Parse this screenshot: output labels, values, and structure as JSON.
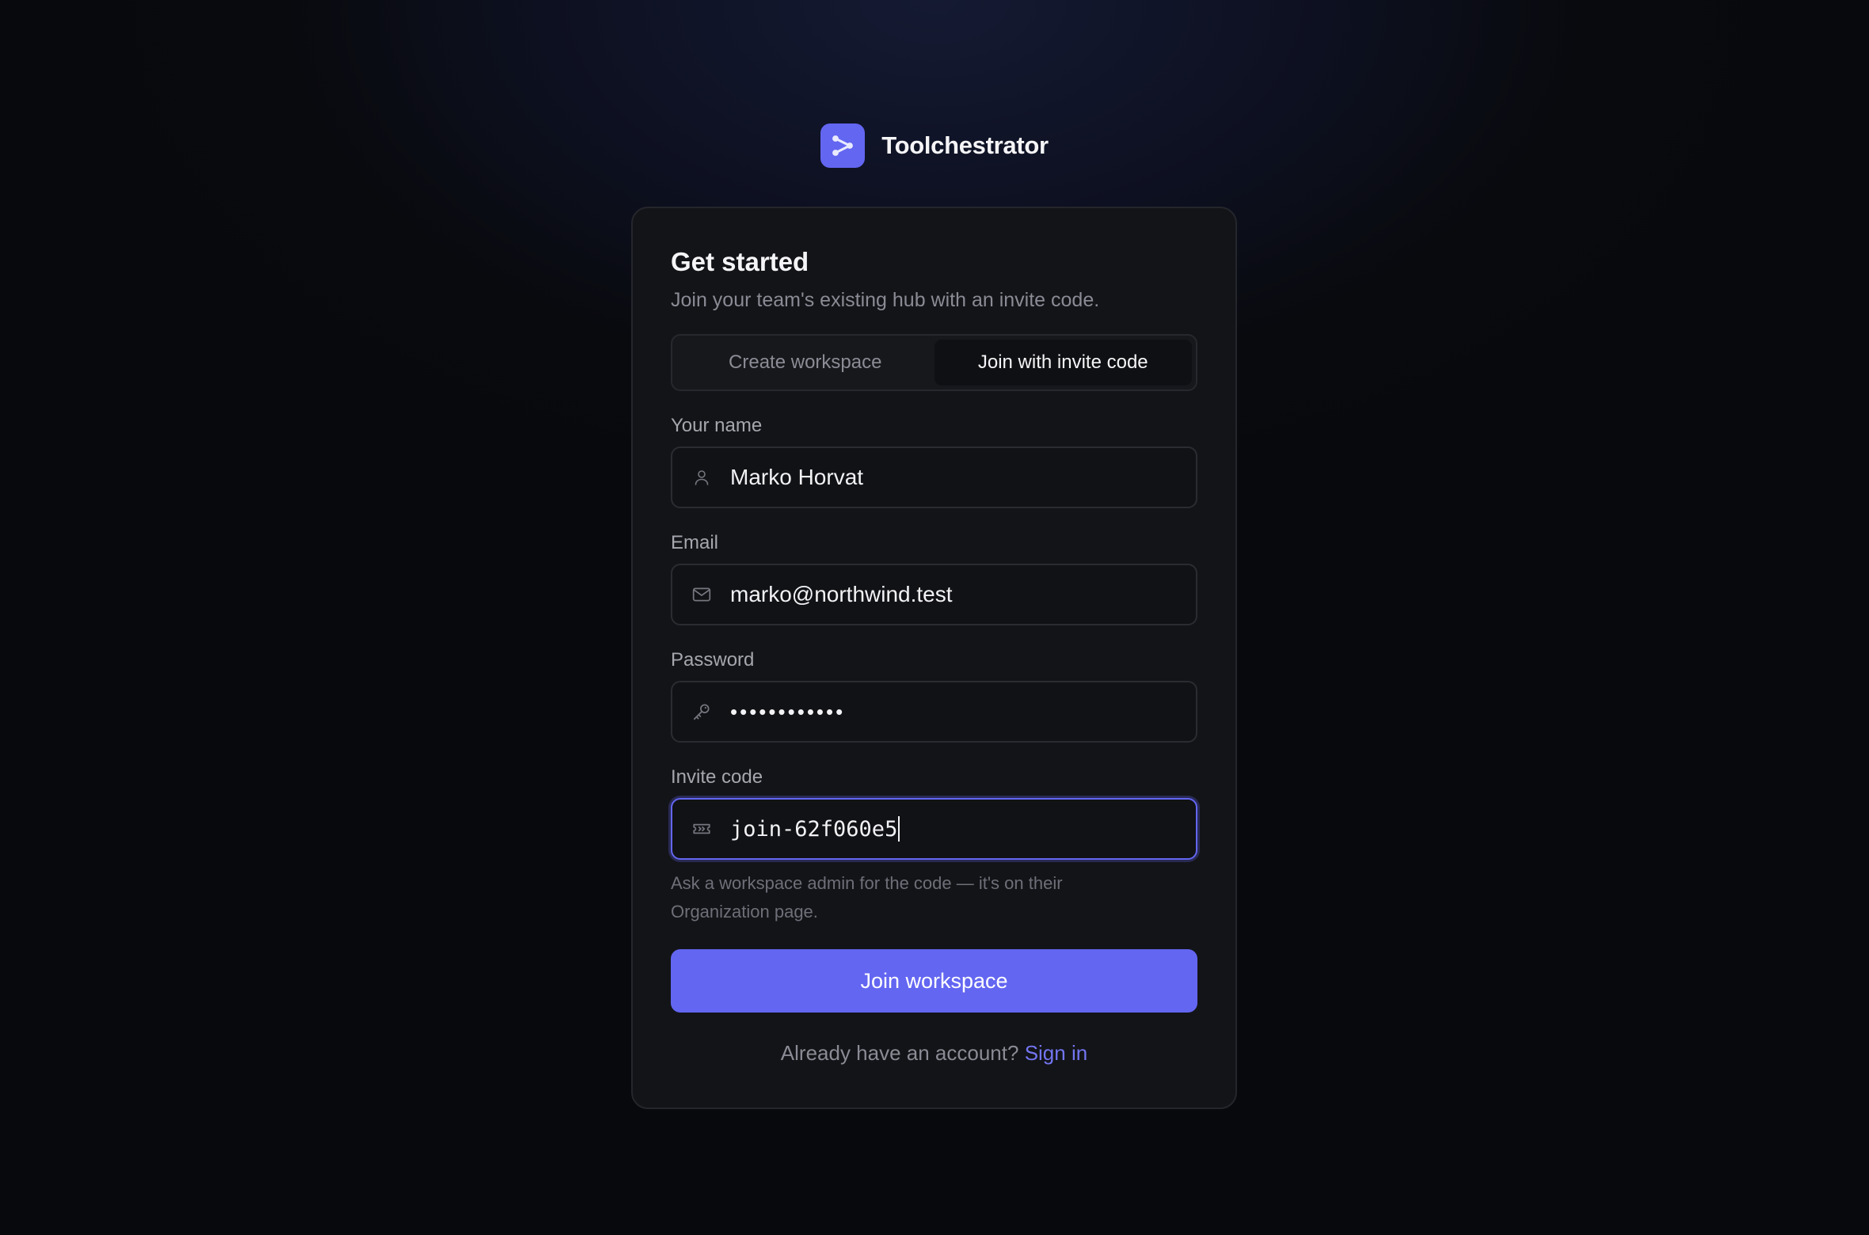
{
  "brand": {
    "name": "Toolchestrator",
    "logo_icon": "share-nodes-icon",
    "accent": "#6366f1"
  },
  "card": {
    "title": "Get started",
    "subtitle": "Join your team's existing hub with an invite code."
  },
  "tabs": {
    "create_label": "Create workspace",
    "join_label": "Join with invite code",
    "active": "join"
  },
  "fields": {
    "name": {
      "label": "Your name",
      "value": "Marko Horvat",
      "icon": "user-icon"
    },
    "email": {
      "label": "Email",
      "value": "marko@northwind.test",
      "icon": "mail-icon"
    },
    "password": {
      "label": "Password",
      "value": "••••••••••••",
      "icon": "key-icon"
    },
    "invite": {
      "label": "Invite code",
      "value": "join-62f060e5",
      "icon": "ticket-icon",
      "hint": "Ask a workspace admin for the code — it's on their Organization page."
    }
  },
  "submit_label": "Join workspace",
  "footer": {
    "prompt": "Already have an account?",
    "link_label": "Sign in"
  }
}
